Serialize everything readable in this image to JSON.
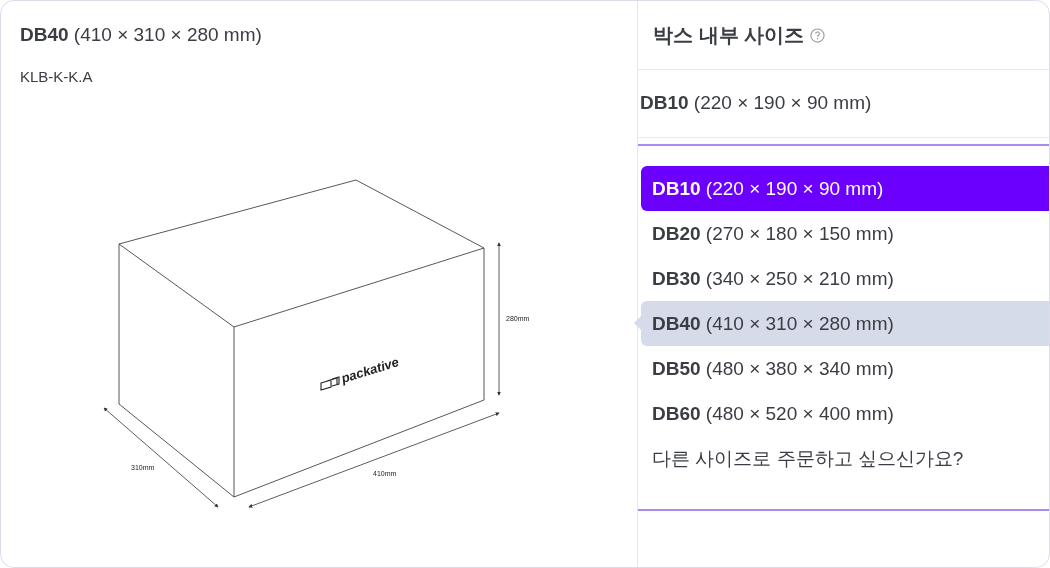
{
  "preview": {
    "code": "DB40",
    "dims": "(410 × 310 × 280 mm)",
    "sku": "KLB-K-K.A",
    "drawing": {
      "height_label": "280mm",
      "width_label": "410mm",
      "depth_label": "310mm",
      "logo": "packative"
    }
  },
  "size_picker": {
    "label": "박스 내부 사이즈",
    "value_code": "DB10",
    "value_dims": "(220 × 190 × 90 mm)",
    "options": [
      {
        "kind": "size",
        "code": "DB10",
        "dims": "(220 × 190 × 90 mm)",
        "selected": true,
        "hovered": false
      },
      {
        "kind": "size",
        "code": "DB20",
        "dims": "(270 × 180 × 150 mm)",
        "selected": false,
        "hovered": false
      },
      {
        "kind": "size",
        "code": "DB30",
        "dims": "(340 × 250 × 210 mm)",
        "selected": false,
        "hovered": false
      },
      {
        "kind": "size",
        "code": "DB40",
        "dims": "(410 × 310 × 280 mm)",
        "selected": false,
        "hovered": true
      },
      {
        "kind": "size",
        "code": "DB50",
        "dims": "(480 × 380 × 340 mm)",
        "selected": false,
        "hovered": false
      },
      {
        "kind": "size",
        "code": "DB60",
        "dims": "(480 × 520 × 400 mm)",
        "selected": false,
        "hovered": false
      },
      {
        "kind": "custom",
        "text": "다른 사이즈로 주문하고 싶으신가요?",
        "selected": false,
        "hovered": false
      }
    ]
  }
}
